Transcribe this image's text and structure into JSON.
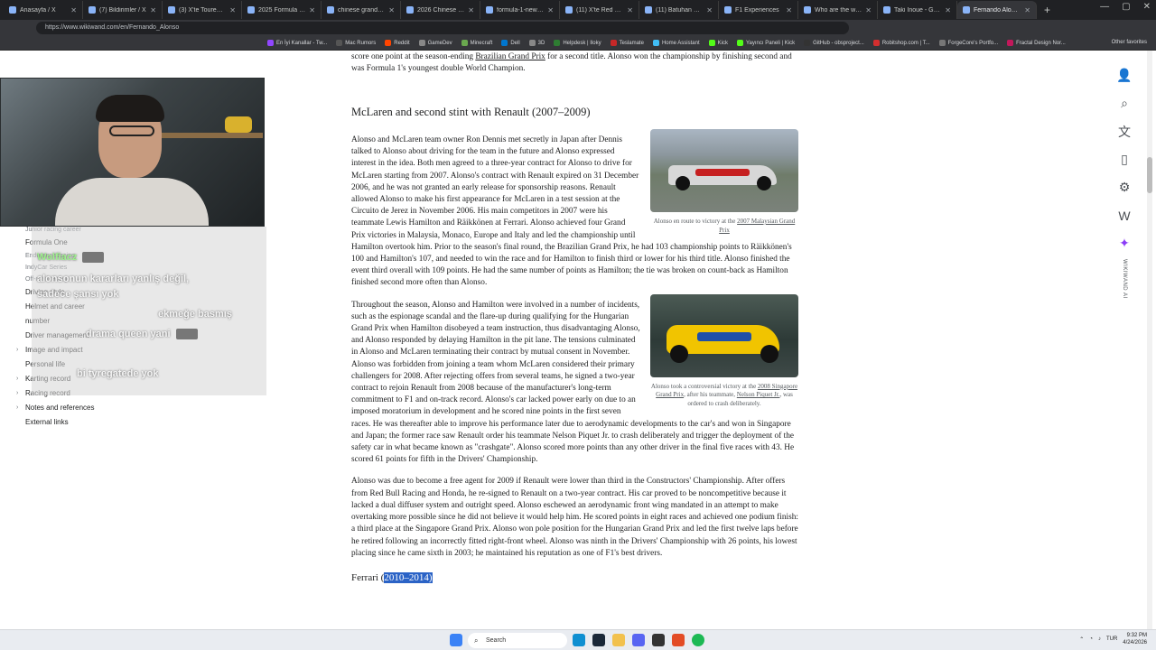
{
  "browser": {
    "tabs": [
      {
        "label": "Anasayfa / X",
        "active": false
      },
      {
        "label": "(7) Bildirimler / X",
        "active": false
      },
      {
        "label": "(3) X'te Tourens: \"",
        "active": false
      },
      {
        "label": "2025 Formula One W",
        "active": false
      },
      {
        "label": "chinese grand prix tick",
        "active": false
      },
      {
        "label": "2026 Chinese Grand P",
        "active": false
      },
      {
        "label": "formula-1-news-2026",
        "active": false
      },
      {
        "label": "(11) X'te Red Bull Türk",
        "active": false
      },
      {
        "label": "(11) Batuhan Bozkan",
        "active": false
      },
      {
        "label": "F1 Experiences",
        "active": false
      },
      {
        "label": "Who are the worst dri",
        "active": false
      },
      {
        "label": "Taki Inoue - Google S",
        "active": false
      },
      {
        "label": "Fernando Alonso - Wik",
        "active": true
      }
    ],
    "url": "https://www.wikiwand.com/en/Fernando_Alonso",
    "bookmarks": [
      "En İyi Kanallar - Tw...",
      "Mac Rumors",
      "Reddit",
      "GameDev",
      "Minecraft",
      "Dell",
      "3D",
      "Helpdesk | Iloky",
      "Teslamate",
      "Home Assistant",
      "Kick",
      "Yayıncı Paneli | Kick",
      "GitHub - obsproject...",
      "Robitshop.com | T...",
      "ForgeCore's Portfo...",
      "Fractal Design Nor..."
    ],
    "other_bookmarks": "Other favorites"
  },
  "sidebar": {
    "items": [
      {
        "label": "Junior racing career",
        "chev": false,
        "small": true
      },
      {
        "label": "Formula One",
        "chev": false,
        "small": false
      },
      {
        "label": "Endurance racing",
        "chev": false,
        "small": true
      },
      {
        "label": "IndyCar Series",
        "chev": false,
        "small": true
      },
      {
        "label": "Off-road racing",
        "chev": false,
        "small": true
      },
      {
        "label": "Driving style",
        "chev": false,
        "small": false
      },
      {
        "label": "Helmet and career",
        "chev": false,
        "small": false
      },
      {
        "label": "number",
        "chev": false,
        "small": false
      },
      {
        "label": "Driver management",
        "chev": false,
        "small": false
      },
      {
        "label": "Image and impact",
        "chev": true,
        "small": false
      },
      {
        "label": "Personal life",
        "chev": false,
        "small": false
      },
      {
        "label": "Karting record",
        "chev": true,
        "small": false
      },
      {
        "label": "Racing record",
        "chev": true,
        "small": false
      },
      {
        "label": "Notes and references",
        "chev": true,
        "small": false
      },
      {
        "label": "External links",
        "chev": false,
        "small": false
      }
    ]
  },
  "chat": {
    "lines": [
      {
        "user": "Wolfiacz",
        "text": ""
      },
      {
        "user": "",
        "text": "alonsonun kararları yanlış değil,"
      },
      {
        "user": "",
        "text": "sadece şansı yok"
      },
      {
        "user": "",
        "text": "ekmeğe basmış"
      },
      {
        "user": "",
        "text": "drama queen yani"
      },
      {
        "user": "",
        "text": "bi tyregatede yok"
      }
    ]
  },
  "article": {
    "intro_text": "score one point at the season-ending ",
    "intro_link": "Brazilian Grand Prix",
    "intro_rest": " for a second title. Alonso won the championship by finishing second and was Formula 1's youngest double World Champion.",
    "heading": "McLaren and second stint with Renault (2007–2009)",
    "fig1_caption_pre": "Alonso en route to victory at the ",
    "fig1_caption_link": "2007 Malaysian Grand Prix",
    "fig2_caption_pre": "Alonso took a controversial victory at the ",
    "fig2_caption_link": "2008 Singapore Grand Prix",
    "fig2_caption_mid": ", after his teammate, ",
    "fig2_caption_link2": "Nelson Piquet Jr.",
    "fig2_caption_post": ", was ordered to crash deliberately.",
    "p1": "Alonso and McLaren team owner Ron Dennis met secretly in Japan after Dennis talked to Alonso about driving for the team in the future and Alonso expressed interest in the idea. Both men agreed to a three-year contract for Alonso to drive for McLaren starting from 2007. Alonso's contract with Renault expired on 31 December 2006, and he was not granted an early release for sponsorship reasons. Renault allowed Alonso to make his first appearance for McLaren in a test session at the Circuito de Jerez in November 2006. His main competitors in 2007 were his teammate Lewis Hamilton and Räikkönen at Ferrari. Alonso achieved four Grand Prix victories in Malaysia, Monaco, Europe and Italy and led the championship until Hamilton overtook him. Prior to the season's final round, the Brazilian Grand Prix, he had 103 championship points to Räikkönen's 100 and Hamilton's 107, and needed to win the race and for Hamilton to finish third or lower for his third title. Alonso finished the event third overall with 109 points. He had the same number of points as Hamilton; the tie was broken on count-back as Hamilton finished second more often than Alonso.",
    "p2": "Throughout the season, Alonso and Hamilton were involved in a number of incidents, such as the espionage scandal and the flare-up during qualifying for the Hungarian Grand Prix when Hamilton disobeyed a team instruction, thus disadvantaging Alonso, and Alonso responded by delaying Hamilton in the pit lane. The tensions culminated in Alonso and McLaren terminating their contract by mutual consent in November. Alonso was forbidden from joining a team whom McLaren considered their primary challengers for 2008. After rejecting offers from several teams, he signed a two-year contract to rejoin Renault from 2008 because of the manufacturer's long-term commitment to F1 and on-track record. Alonso's car lacked power early on due to an imposed moratorium in development and he scored nine points in the first seven races. He was thereafter able to improve his performance later due to aerodynamic developments to the car's and won in Singapore and Japan; the former race saw Renault order his teammate Nelson Piquet Jr. to crash deliberately and trigger the deployment of the safety car in what became known as \"crashgate\". Alonso scored more points than any other driver in the final five races with 43. He scored 61 points for fifth in the Drivers' Championship.",
    "p3": "Alonso was due to become a free agent for 2009 if Renault were lower than third in the Constructors' Championship. After offers from Red Bull Racing and Honda, he re-signed to Renault on a two-year contract. His car proved to be noncompetitive because it lacked a dual diffuser system and outright speed. Alonso eschewed an aerodynamic front wing mandated in an attempt to make overtaking more possible since he did not believe it would help him. He scored points in eight races and achieved one podium finish: a third place at the Singapore Grand Prix. Alonso won pole position for the Hungarian Grand Prix and led the first twelve laps before he retired following an incorrectly fitted right-front wheel. Alonso was ninth in the Drivers' Championship with 26 points, his lowest placing since he came sixth in 2003; he maintained his reputation as one of F1's best drivers.",
    "next_section_pre": "Ferrari (",
    "next_section_sel": "2010–2014)"
  },
  "tools": [
    "person-icon",
    "search-icon",
    "translate-icon",
    "bookmark-icon",
    "settings-icon",
    "wikipedia-icon",
    "sparkle-icon"
  ],
  "tools_ai_label": "WIKIWAND AI",
  "taskbar": {
    "search_placeholder": "Search",
    "lang": "TUR",
    "time": "9:32 PM",
    "date": "4/24/2026"
  }
}
